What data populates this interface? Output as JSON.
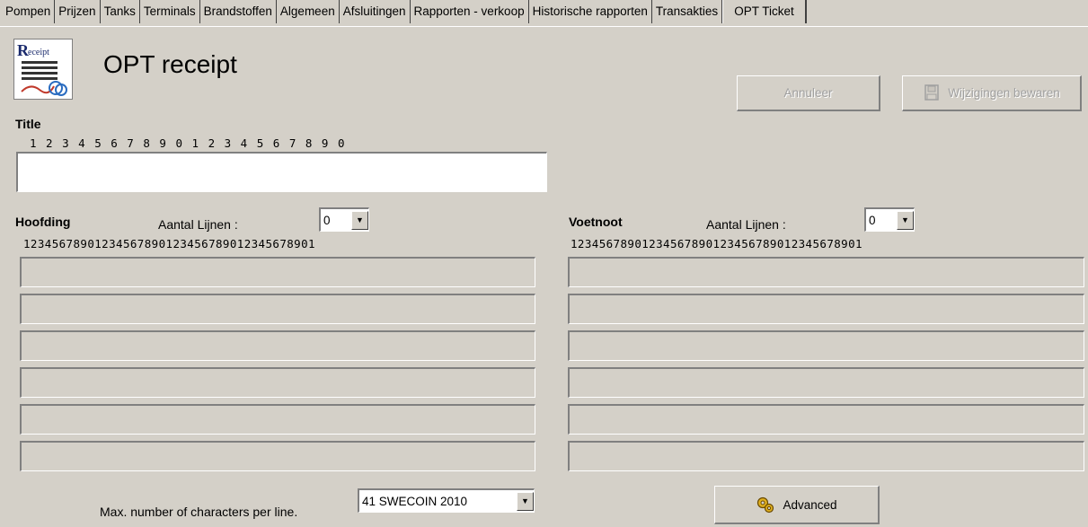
{
  "tabs": [
    {
      "label": "Pompen"
    },
    {
      "label": "Prijzen"
    },
    {
      "label": "Tanks"
    },
    {
      "label": "Terminals"
    },
    {
      "label": "Brandstoffen"
    },
    {
      "label": "Algemeen"
    },
    {
      "label": "Afsluitingen"
    },
    {
      "label": "Rapporten - verkoop"
    },
    {
      "label": "Historische rapporten"
    },
    {
      "label": "Transakties"
    },
    {
      "label": "OPT Ticket"
    }
  ],
  "header": {
    "icon_text": "Receipt",
    "title": "OPT receipt",
    "cancel_label": "Annuleer",
    "save_label": "Wijzigingen bewaren"
  },
  "title_section": {
    "label": "Title",
    "ruler": "1 2 3 4 5 6 7 8 9 0 1 2 3 4 5 6 7 8 9 0",
    "value": ""
  },
  "header_section": {
    "label": "Hoofding",
    "lines_label": "Aantal Lijnen :",
    "lines_value": "0",
    "ruler": "12345678901234567890123456789012345678901",
    "lines": [
      "",
      "",
      "",
      "",
      "",
      ""
    ]
  },
  "footer_section": {
    "label": "Voetnoot",
    "lines_label": "Aantal Lijnen :",
    "lines_value": "0",
    "ruler": "12345678901234567890123456789012345678901",
    "lines": [
      "",
      "",
      "",
      "",
      "",
      ""
    ]
  },
  "bottom": {
    "max_chars_label": "Max. number of characters per line.",
    "max_chars_value": "41  SWECOIN 2010",
    "advanced_label": "Advanced"
  }
}
